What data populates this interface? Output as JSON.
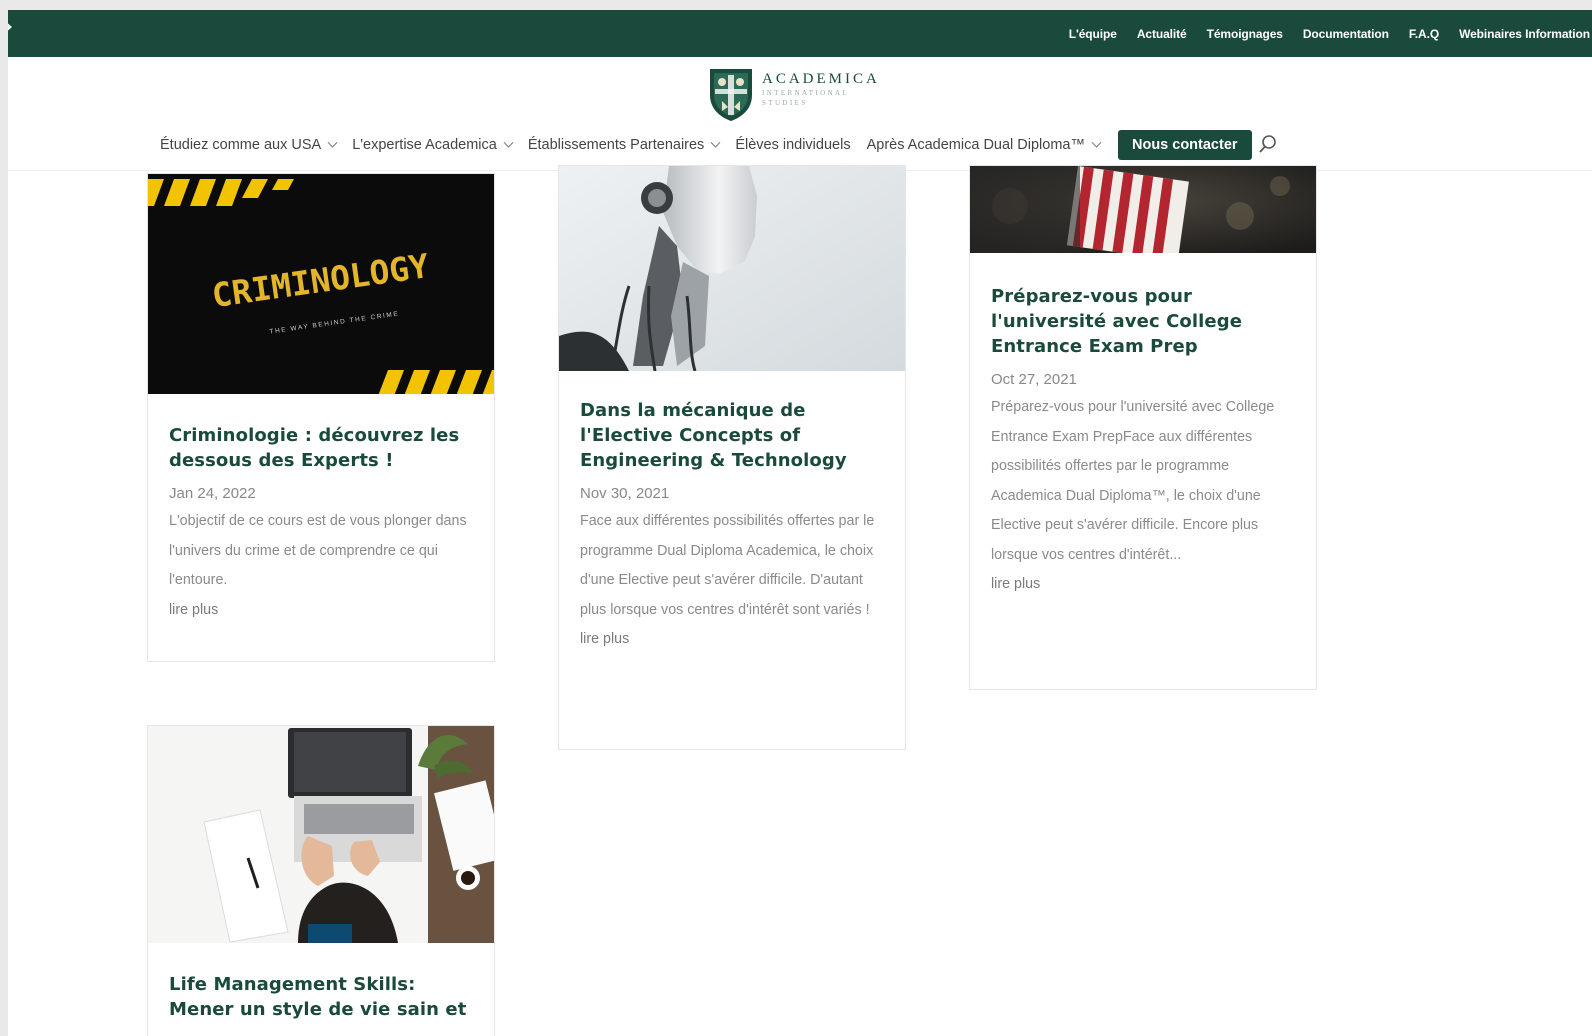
{
  "topbar": {
    "links": [
      "L'équipe",
      "Actualité",
      "Témoignages",
      "Documentation",
      "F.A.Q",
      "Webinaires Information"
    ]
  },
  "logo": {
    "name": "ACADEMICA",
    "line1": "INTERNATIONAL",
    "line2": "STUDIES"
  },
  "nav": {
    "items": [
      {
        "label": "Étudiez comme aux USA",
        "has_dropdown": true
      },
      {
        "label": "L'expertise Academica",
        "has_dropdown": true
      },
      {
        "label": "Établissements Partenaires",
        "has_dropdown": true
      },
      {
        "label": "Élèves individuels",
        "has_dropdown": false
      },
      {
        "label": "Après Academica Dual Diploma™",
        "has_dropdown": true
      }
    ],
    "contact_label": "Nous contacter"
  },
  "colors": {
    "brand": "#1a4a3b",
    "title": "#1a4a3b",
    "muted": "#8a8a8a"
  },
  "posts": [
    {
      "image_text": "CRIMINOLOGY",
      "image_subtext": "THE WAY BEHIND THE CRIME",
      "title": "Criminologie : découvrez les dessous des Experts !",
      "date": "Jan 24, 2022",
      "excerpt": "L'objectif de ce cours est de vous plonger dans l'univers du crime et de comprendre ce qui l'entoure.",
      "more": "lire plus"
    },
    {
      "title": "Dans la mécanique de l'Elective Concepts of Engineering & Technology",
      "date": "Nov 30, 2021",
      "excerpt": "Face aux différentes possibilités offertes par le programme Dual Diploma Academica, le choix d'une Elective peut s'avérer difficile. D'autant plus lorsque vos centres d'intérêt sont variés !",
      "more": "lire plus"
    },
    {
      "title": "Préparez-vous pour l'université avec College Entrance Exam Prep",
      "date": "Oct 27, 2021",
      "excerpt": "Préparez-vous pour l'université avec College Entrance Exam PrepFace aux différentes possibilités offertes par le programme Academica Dual Diploma™, le choix d'une Elective peut s'avérer difficile. Encore plus lorsque vos centres d'intérêt...",
      "more": "lire plus"
    },
    {
      "title": "Life Management Skills: Mener un style de vie sain et"
    }
  ]
}
